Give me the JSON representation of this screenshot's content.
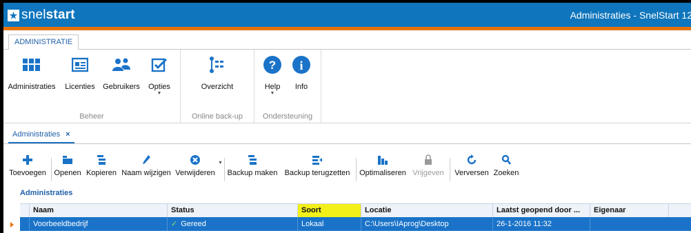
{
  "app": {
    "logo_light": "snel",
    "logo_bold": "start",
    "window_title": "Administraties - SnelStart 12",
    "brand_color": "#0f75bc",
    "accent_color": "#e8730c"
  },
  "ribbon": {
    "tab": "ADMINISTRATIE",
    "groups": [
      {
        "label": "Beheer",
        "buttons": [
          {
            "label": "Administraties",
            "icon": "grid-icon"
          },
          {
            "label": "Licenties",
            "icon": "license-card-icon"
          },
          {
            "label": "Gebruikers",
            "icon": "users-icon"
          },
          {
            "label": "Opties",
            "icon": "checkbox-icon"
          }
        ]
      },
      {
        "label": "Online back-up",
        "buttons": [
          {
            "label": "Overzicht",
            "icon": "overview-tree-icon"
          }
        ]
      },
      {
        "label": "Ondersteuning",
        "buttons": [
          {
            "label": "Help",
            "icon": "help-circle-icon"
          },
          {
            "label": "Info",
            "icon": "info-circle-icon"
          }
        ]
      }
    ]
  },
  "doc_tab": {
    "label": "Administraties",
    "close": "×"
  },
  "toolbar": {
    "buttons": [
      {
        "label": "Toevoegen",
        "icon": "plus-icon"
      },
      {
        "label": "Openen",
        "icon": "folder-icon"
      },
      {
        "label": "Kopieren",
        "icon": "copy-icon"
      },
      {
        "label": "Naam wijzigen",
        "icon": "pencil-icon"
      },
      {
        "label": "Verwijderen",
        "icon": "delete-circle-icon"
      },
      {
        "label": "Backup maken",
        "icon": "backup-icon"
      },
      {
        "label": "Backup terugzetten",
        "icon": "restore-icon"
      },
      {
        "label": "Optimaliseren",
        "icon": "optimize-icon"
      },
      {
        "label": "Vrijgeven",
        "icon": "lock-icon"
      },
      {
        "label": "Verversen",
        "icon": "refresh-icon"
      },
      {
        "label": "Zoeken",
        "icon": "search-icon"
      }
    ]
  },
  "grid": {
    "title": "Administraties",
    "columns": [
      "Naam",
      "Status",
      "Soort",
      "Locatie",
      "Laatst geopend door ...",
      "Eigenaar"
    ],
    "sort_indicator": "▼",
    "highlight_color": "#f3ef19",
    "rows": [
      {
        "naam": "Voorbeeldbedrijf",
        "status": "Gereed",
        "soort": "Lokaal",
        "locatie": "C:\\Users\\IAprog\\Desktop",
        "laatst": "26-1-2016 11:32",
        "eigenaar": ""
      }
    ]
  }
}
